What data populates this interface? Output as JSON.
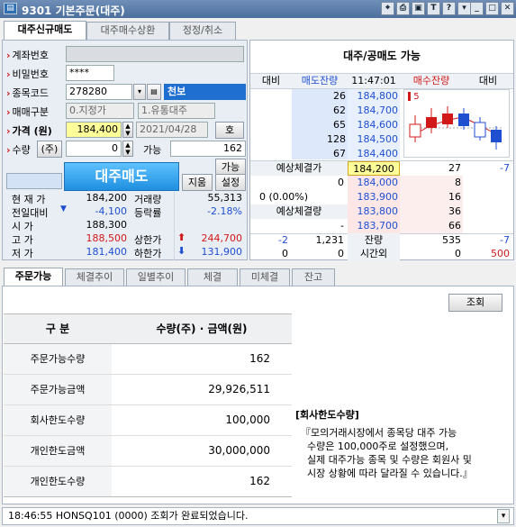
{
  "window": {
    "title": "9301 기본주문(대주)",
    "icons": [
      "pin-icon",
      "print-icon",
      "screen-icon",
      "text-icon",
      "help-icon",
      "dropdown-icon",
      "minimize-icon",
      "maximize-icon",
      "close-icon"
    ]
  },
  "tabs_top": [
    "대주신규매도",
    "대주매수상환",
    "정정/취소"
  ],
  "form": {
    "account_label": "계좌번호",
    "password_label": "비밀번호",
    "password_value": "****",
    "code_label": "종목코드",
    "code_value": "278280",
    "stock_name": "천보",
    "trade_type_label": "매매구분",
    "trade_type_value": "0.지정가",
    "condition_value": "1.유통대주",
    "price_label": "가격 (원)",
    "price_value": "184,400",
    "date_value": "2021/04/28",
    "price_btn": "호",
    "qty_label": "수량",
    "qty_unit": "(주)",
    "qty_value": "0",
    "avail_label": "가능",
    "avail_value": "162",
    "avail_btn": "가능",
    "sell_btn": "대주매도",
    "clear_btn": "지움",
    "settings_btn": "설정"
  },
  "quotes": {
    "current_label": "현 재 가",
    "current_value": "184,200",
    "volume_label": "거래량",
    "volume_value": "55,313",
    "change_label": "전일대비",
    "change_value": "-4,100",
    "rate_label": "등락률",
    "rate_value": "-2.18%",
    "open_label": "시 가",
    "open_value": "188,300",
    "high_label": "고 가",
    "high_value": "188,500",
    "upper_label": "상한가",
    "upper_value": "244,700",
    "low_label": "저 가",
    "low_value": "181,400",
    "lower_label": "하한가",
    "lower_value": "131,900"
  },
  "orderbook": {
    "header": "대주/공매도 가능",
    "cols": [
      "대비",
      "매도잔량",
      "11:47:01",
      "매수잔량",
      "대비"
    ],
    "asks": [
      {
        "qty": "26",
        "price": "184,800"
      },
      {
        "qty": "62",
        "price": "184,700"
      },
      {
        "qty": "65",
        "price": "184,600"
      },
      {
        "qty": "128",
        "price": "184,500"
      },
      {
        "qty": "67",
        "price": "184,400"
      }
    ],
    "expected_label": "예상체결가",
    "expected_price": "184,200",
    "expected_qty": "27",
    "expected_diff": "-7",
    "expected_diff_left": "0",
    "expected_pct": "0 (0.00%)",
    "expected_vol_label": "예상체결량",
    "expected_vol_dash": "-",
    "bids": [
      {
        "qty": "8",
        "price": "184,000"
      },
      {
        "qty": "16",
        "price": "183,900"
      },
      {
        "qty": "36",
        "price": "183,800"
      },
      {
        "qty": "66",
        "price": "183,700"
      }
    ],
    "bottom1": {
      "diff": "-2",
      "ask_total": "1,231",
      "label": "잔량",
      "bid_total": "535",
      "bid_diff": "-7"
    },
    "bottom2": {
      "a": "0",
      "b": "0",
      "label": "시간외",
      "c": "0",
      "d": "500"
    },
    "chart_marker": "5"
  },
  "tabs_bottom": [
    "주문가능",
    "체결추이",
    "일별추이",
    "체결",
    "미체결",
    "잔고"
  ],
  "lookup_btn": "조회",
  "table": {
    "headers": [
      "구 분",
      "수량(주) · 금액(원)"
    ],
    "rows": [
      {
        "label": "주문가능수량",
        "value": "162"
      },
      {
        "label": "주문가능금액",
        "value": "29,926,511"
      },
      {
        "label": "회사한도수량",
        "value": "100,000"
      },
      {
        "label": "개인한도금액",
        "value": "30,000,000"
      },
      {
        "label": "개인한도수량",
        "value": "162"
      }
    ]
  },
  "note": {
    "title": "[회사한도수량]",
    "line1": "『모의거래시장에서 종목당 대주 가능",
    "line2": "수량은 100,000주로 설정했으며,",
    "line3": "실제 대주가능 종목 및 수량은 회원사 및",
    "line4": "시장 상황에 따라 달라질 수 있습니다.』"
  },
  "status": "18:46:55 HONSQ101 (0000) 조회가 완료되었습니다.",
  "colors": {
    "title_bar": "#5a7caa",
    "ask_bg": "#dde8fb",
    "bid_bg": "#fde6e6",
    "sell_btn": "#2a9ae8",
    "expected_bg": "#ffff9a"
  }
}
